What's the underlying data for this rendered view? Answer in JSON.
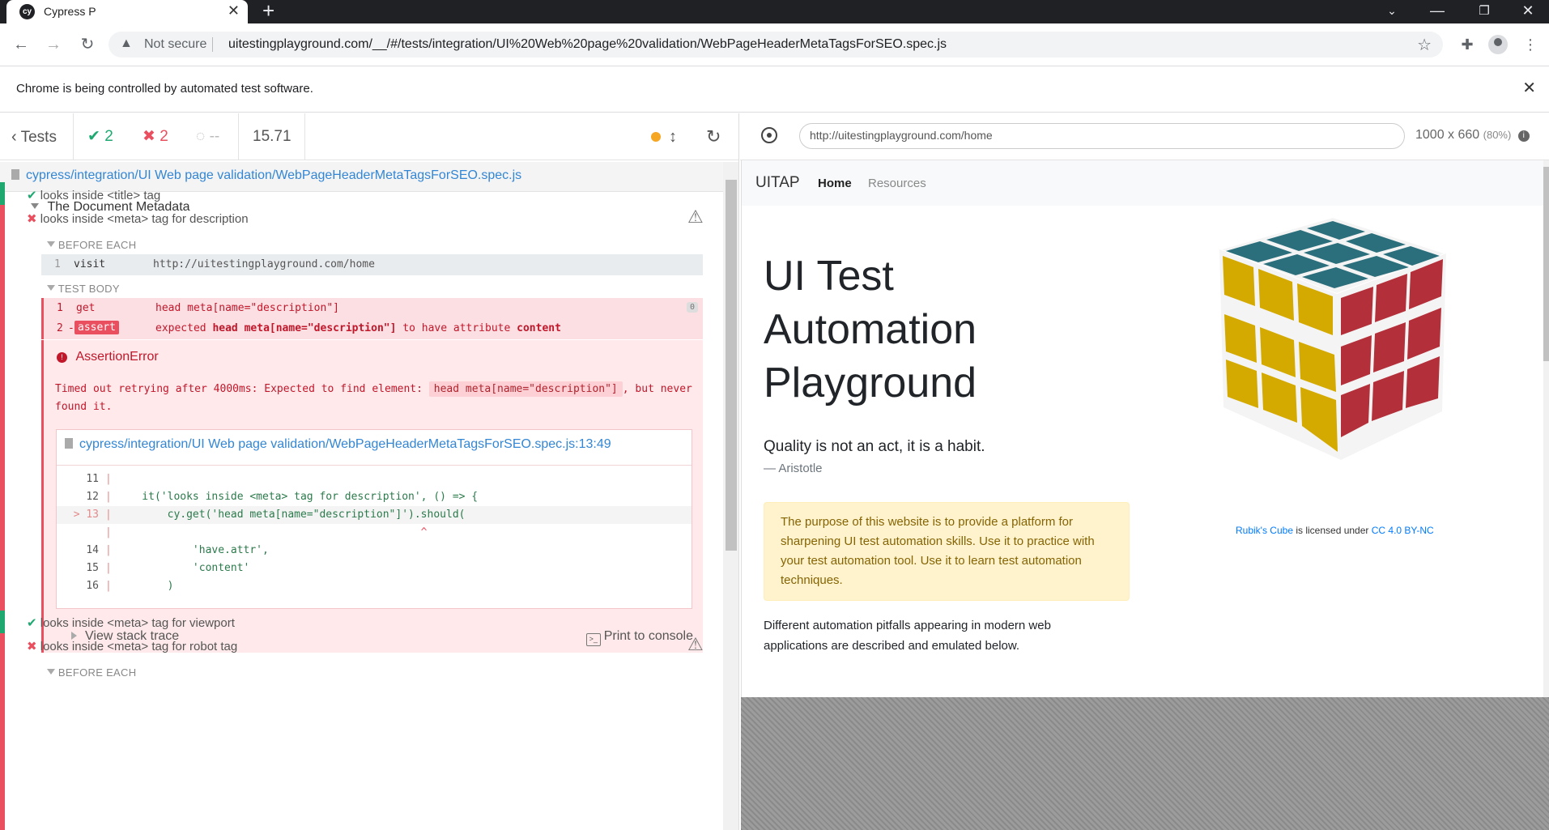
{
  "browser": {
    "tab_title": "Cypress P",
    "favicon_text": "cy",
    "security_label": "Not secure",
    "url": "uitestingplayground.com/__/#/tests/integration/UI%20Web%20page%20validation/WebPageHeaderMetaTagsForSEO.spec.js",
    "infobar_text": "Chrome is being controlled by automated test software."
  },
  "reporter": {
    "tests_label": "Tests",
    "passed_count": "2",
    "failed_count": "2",
    "pending_count": "--",
    "duration": "15.71",
    "spec_path": "cypress/integration/UI Web page validation/WebPageHeaderMetaTagsForSEO.spec.js",
    "suite_title": "The Document Metadata",
    "tests": [
      {
        "title": "looks inside <title> tag",
        "state": "passed"
      },
      {
        "title": "looks inside <meta> tag for description",
        "state": "failed"
      },
      {
        "title": "looks inside <meta> tag for viewport",
        "state": "passed"
      },
      {
        "title": "looks inside <meta> tag for robot tag",
        "state": "failed"
      }
    ],
    "before_each_label": "BEFORE EACH",
    "test_body_label": "TEST BODY",
    "commands": {
      "visit": {
        "num": "1",
        "name": "visit",
        "message": "http://uitestingplayground.com/home"
      },
      "get": {
        "num": "1",
        "name": "get",
        "message": "head meta[name=\"description\"]",
        "badge": "0"
      },
      "assert": {
        "num": "2",
        "prefix": "-",
        "name": "assert",
        "message_expected": "expected",
        "message_selector": "head meta[name=\"description\"]",
        "message_mid": "to have attribute",
        "message_attr": "content"
      }
    },
    "error": {
      "name": "AssertionError",
      "message_pre": "Timed out retrying after 4000ms: Expected to find element:",
      "message_code": "head meta[name=\"description\"]",
      "message_post": ", but never found it.",
      "file_link": "cypress/integration/UI Web page validation/WebPageHeaderMetaTagsForSEO.spec.js:13:49",
      "code_lines": [
        {
          "marker": "",
          "num": "11",
          "src": ""
        },
        {
          "marker": "",
          "num": "12",
          "src": "    it('looks inside <meta> tag for description', () => {"
        },
        {
          "marker": ">",
          "num": "13",
          "src": "        cy.get('head meta[name=\"description\"]').should("
        },
        {
          "marker": "",
          "num": "",
          "src": "                                                ^"
        },
        {
          "marker": "",
          "num": "14",
          "src": "            'have.attr',"
        },
        {
          "marker": "",
          "num": "15",
          "src": "            'content'"
        },
        {
          "marker": "",
          "num": "16",
          "src": "        )"
        }
      ],
      "stack_trace_label": "View stack trace",
      "print_label": "Print to console"
    }
  },
  "aut": {
    "url": "http://uitestingplayground.com/home",
    "size": "1000 x 660",
    "zoom": "(80%)",
    "site": {
      "brand": "UITAP",
      "nav_home": "Home",
      "nav_resources": "Resources",
      "hero_title": "UI Test Automation Playground",
      "quote": "Quality is not an act, it is a habit.",
      "quote_author": "— Aristotle",
      "alert_text": "The purpose of this website is to provide a platform for sharpening UI test automation skills. Use it to practice with your test automation tool. Use it to learn test automation techniques.",
      "lead_text": "Different automation pitfalls appearing in modern web applications are described and emulated below.",
      "caption_link1": "Rubik's Cube",
      "caption_mid": " is licensed under ",
      "caption_link2": "CC 4.0 BY-NC"
    }
  },
  "colors": {
    "pass": "#1fa971",
    "fail": "#e94f5f",
    "link": "#3386d4",
    "running": "#f5a623"
  }
}
